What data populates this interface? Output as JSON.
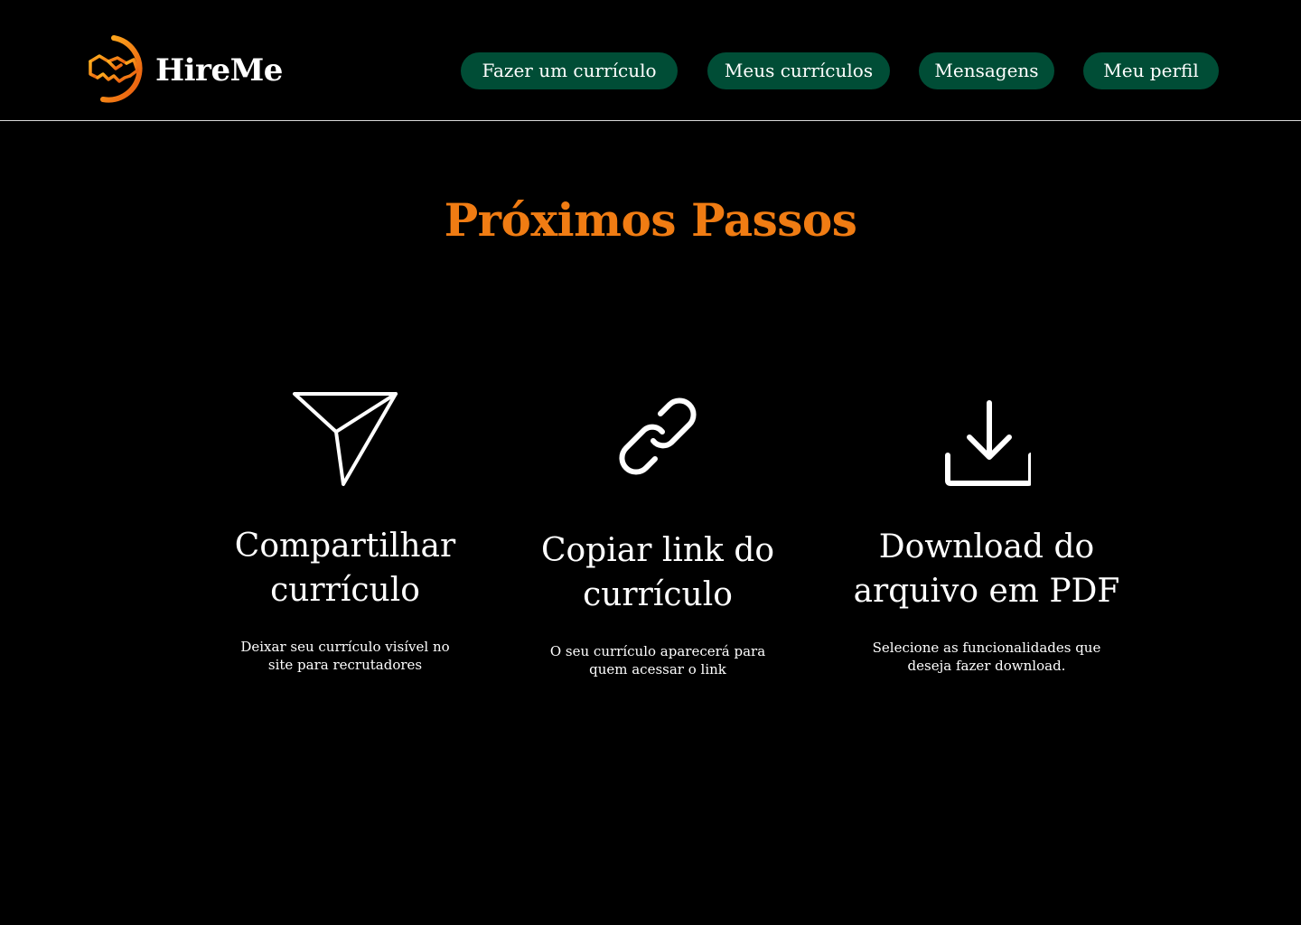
{
  "header": {
    "logo_text": "HireMe",
    "logo_icon": "handshake-icon",
    "nav": [
      {
        "label": "Fazer um currículo"
      },
      {
        "label": "Meus currículos"
      },
      {
        "label": "Mensagens"
      },
      {
        "label": "Meu perfil"
      }
    ]
  },
  "main": {
    "title": "Próximos Passos",
    "steps": [
      {
        "icon": "send-icon",
        "title_line1": "Compartilhar",
        "title_line2": "currículo",
        "desc": "Deixar seu currículo visível no site para recrutadores"
      },
      {
        "icon": "link-icon",
        "title_line1": "Copiar link do",
        "title_line2": "currículo",
        "desc": "O seu currículo aparecerá para quem acessar o link"
      },
      {
        "icon": "download-icon",
        "title_line1": "Download do",
        "title_line2": "arquivo em PDF",
        "desc": "Selecione as funcionalidades que deseja fazer download."
      }
    ]
  },
  "colors": {
    "background": "#000000",
    "accent": "#f07c13",
    "nav_button": "#004d36",
    "text": "#ffffff",
    "divider": "#d9d9d9"
  }
}
